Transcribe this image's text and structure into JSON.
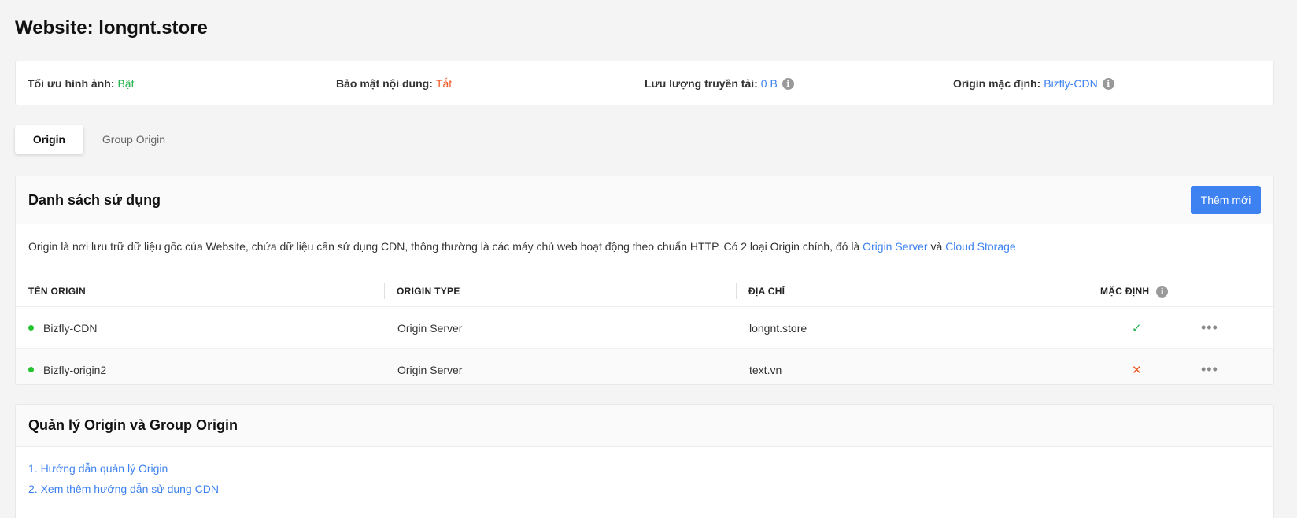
{
  "page": {
    "title": "Website: longnt.store"
  },
  "stats": [
    {
      "label": "Tối ưu hình ảnh:",
      "value": "Bật",
      "color": "#22b14c",
      "info": false
    },
    {
      "label": "Bảo mật nội dung:",
      "value": "Tắt",
      "color": "#ee5521",
      "info": false
    },
    {
      "label": "Lưu lượng truyền tải:",
      "value": "0 B",
      "color": "#3d82f0",
      "info": true
    },
    {
      "label": "Origin mặc định:",
      "value": "Bizfly-CDN",
      "color": "#3d82f0",
      "info": true
    }
  ],
  "tabs": [
    {
      "label": "Origin",
      "active": true
    },
    {
      "label": "Group Origin",
      "active": false
    }
  ],
  "list_section": {
    "title": "Danh sách sử dụng",
    "add_button": "Thêm mới",
    "description_prefix": "Origin là nơi lưu trữ dữ liệu gốc của Website, chứa dữ liệu cần sử dụng CDN, thông thường là các máy chủ web hoạt động theo chuẩn HTTP. Có 2 loại Origin chính, đó là ",
    "description_link1": "Origin Server",
    "description_middle": " và ",
    "description_link2": "Cloud Storage"
  },
  "table": {
    "columns": [
      "TÊN ORIGIN",
      "ORIGIN TYPE",
      "ĐỊA CHỈ",
      "MẶC ĐỊNH"
    ],
    "rows": [
      {
        "name": "Bizfly-CDN",
        "type": "Origin Server",
        "address": "longnt.store",
        "default": true,
        "status_color": "#22c32e"
      },
      {
        "name": "Bizfly-origin2",
        "type": "Origin Server",
        "address": "text.vn",
        "default": false,
        "status_color": "#22c32e"
      }
    ],
    "more_icon": "more-horizontal-icon",
    "check_glyph": "✓",
    "cross_glyph": "✕"
  },
  "guide_section": {
    "title": "Quản lý Origin và Group Origin",
    "links": [
      "1. Hướng dẫn quản lý Origin",
      "2. Xem thêm hướng dẫn sử dụng CDN"
    ]
  }
}
